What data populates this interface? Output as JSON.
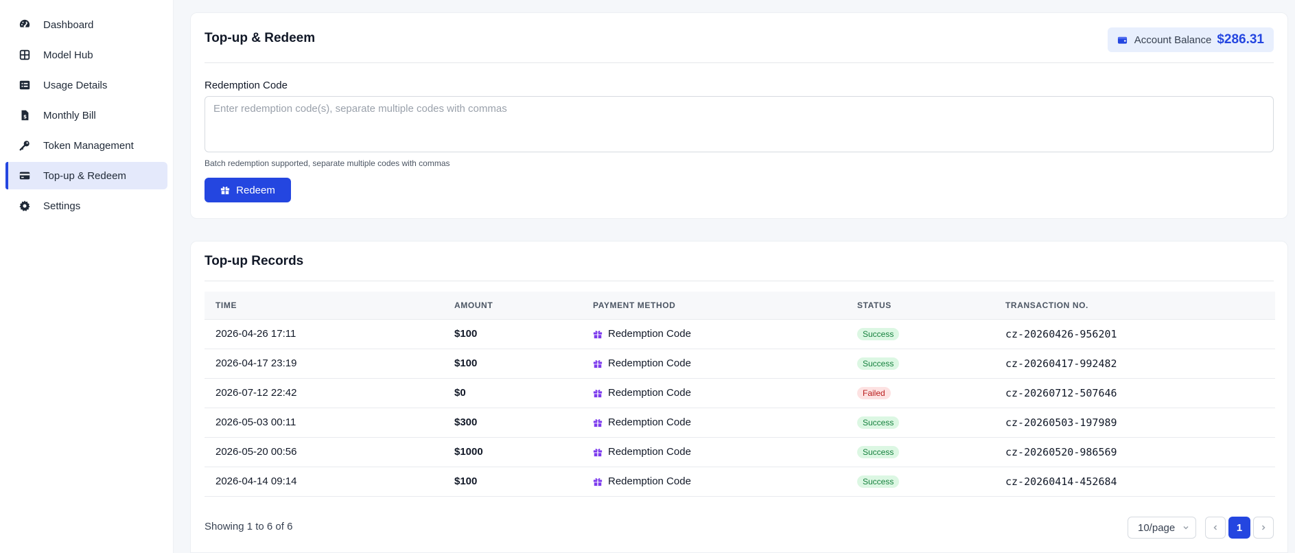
{
  "sidebar": {
    "items": [
      {
        "label": "Dashboard",
        "icon": "gauge-icon"
      },
      {
        "label": "Model Hub",
        "icon": "grid-icon"
      },
      {
        "label": "Usage Details",
        "icon": "list-icon"
      },
      {
        "label": "Monthly Bill",
        "icon": "invoice-icon"
      },
      {
        "label": "Token Management",
        "icon": "key-icon"
      },
      {
        "label": "Top-up & Redeem",
        "icon": "credit-card-icon",
        "active": true
      },
      {
        "label": "Settings",
        "icon": "gear-icon"
      }
    ]
  },
  "redeem": {
    "title": "Top-up & Redeem",
    "balance_label": "Account Balance",
    "balance_value": "$286.31",
    "field_label": "Redemption Code",
    "placeholder": "Enter redemption code(s), separate multiple codes with commas",
    "hint": "Batch redemption supported, separate multiple codes with commas",
    "button_label": "Redeem"
  },
  "records": {
    "title": "Top-up Records",
    "columns": [
      "TIME",
      "AMOUNT",
      "PAYMENT METHOD",
      "STATUS",
      "TRANSACTION NO."
    ],
    "rows": [
      {
        "time": "2026-04-26 17:11",
        "amount": "$100",
        "method": "Redemption Code",
        "status": "Success",
        "txn": "cz-20260426-956201"
      },
      {
        "time": "2026-04-17 23:19",
        "amount": "$100",
        "method": "Redemption Code",
        "status": "Success",
        "txn": "cz-20260417-992482"
      },
      {
        "time": "2026-07-12 22:42",
        "amount": "$0",
        "method": "Redemption Code",
        "status": "Failed",
        "txn": "cz-20260712-507646"
      },
      {
        "time": "2026-05-03 00:11",
        "amount": "$300",
        "method": "Redemption Code",
        "status": "Success",
        "txn": "cz-20260503-197989"
      },
      {
        "time": "2026-05-20 00:56",
        "amount": "$1000",
        "method": "Redemption Code",
        "status": "Success",
        "txn": "cz-20260520-986569"
      },
      {
        "time": "2026-04-14 09:14",
        "amount": "$100",
        "method": "Redemption Code",
        "status": "Success",
        "txn": "cz-20260414-452684"
      }
    ],
    "showing": "Showing 1 to 6 of 6",
    "page_size": "10/page",
    "current_page": "1"
  },
  "colors": {
    "accent": "#2446e0",
    "success": "#15803d",
    "failed": "#b91c1c",
    "method_icon": "#7c3aed"
  }
}
